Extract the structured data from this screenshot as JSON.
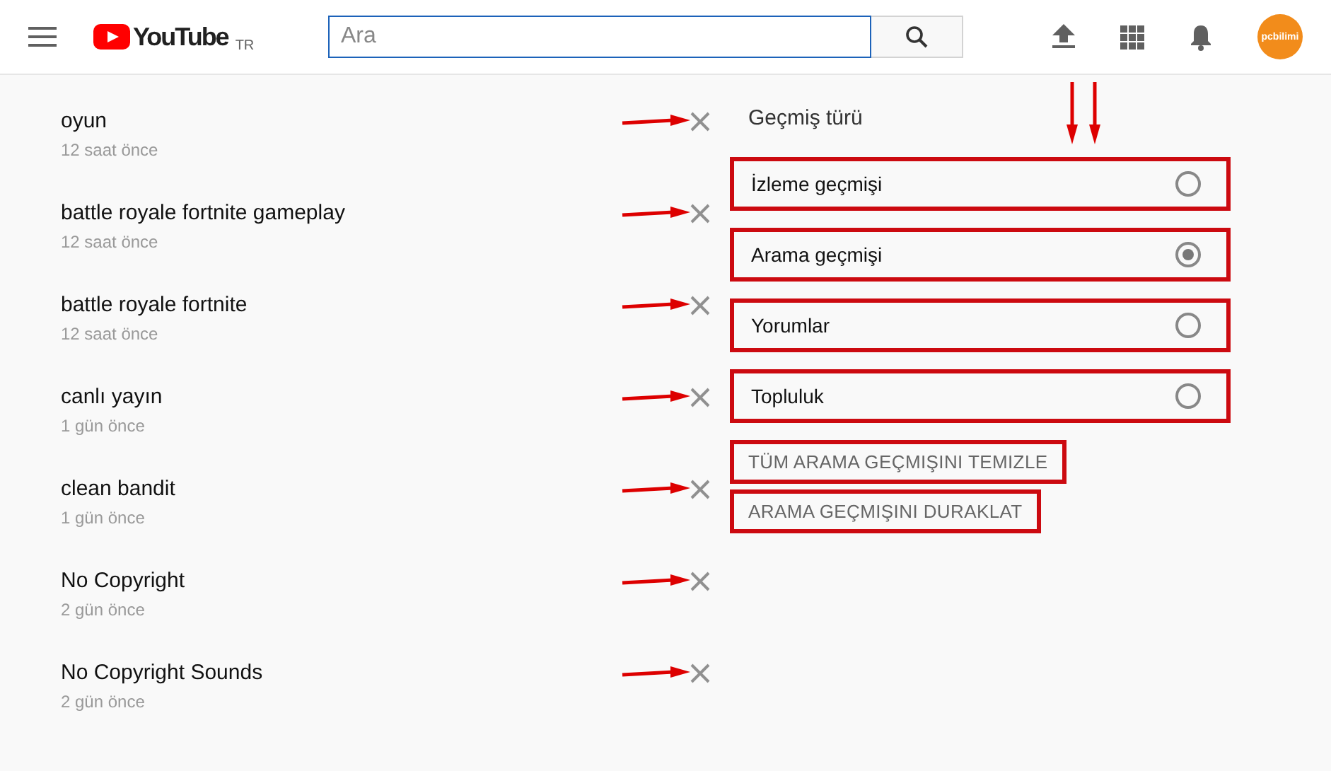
{
  "header": {
    "logo_text": "YouTube",
    "region": "TR",
    "search": {
      "placeholder": "Ara"
    },
    "avatar_text": "pcbilimi"
  },
  "history": [
    {
      "query": "oyun",
      "time": "12 saat önce",
      "annotated": true
    },
    {
      "query": "battle royale fortnite gameplay",
      "time": "12 saat önce",
      "annotated": true
    },
    {
      "query": "battle royale fortnite",
      "time": "12 saat önce",
      "annotated": true
    },
    {
      "query": "canlı yayın",
      "time": "1 gün önce",
      "annotated": true
    },
    {
      "query": "clean bandit",
      "time": "1 gün önce",
      "annotated": true
    },
    {
      "query": "No Copyright",
      "time": "2 gün önce",
      "annotated": true
    },
    {
      "query": "No Copyright Sounds",
      "time": "2 gün önce",
      "annotated": true
    }
  ],
  "history_type": {
    "title": "Geçmiş türü",
    "options": [
      {
        "label": "İzleme geçmişi",
        "selected": false,
        "annotated": true
      },
      {
        "label": "Arama geçmişi",
        "selected": true,
        "annotated": true
      },
      {
        "label": "Yorumlar",
        "selected": false,
        "annotated": true
      },
      {
        "label": "Topluluk",
        "selected": false,
        "annotated": true
      }
    ]
  },
  "actions": [
    {
      "label": "TÜM ARAMA GEÇMIŞINI TEMIZLE",
      "annotated": true
    },
    {
      "label": "ARAMA GEÇMIŞINI DURAKLAT",
      "annotated": true
    }
  ]
}
